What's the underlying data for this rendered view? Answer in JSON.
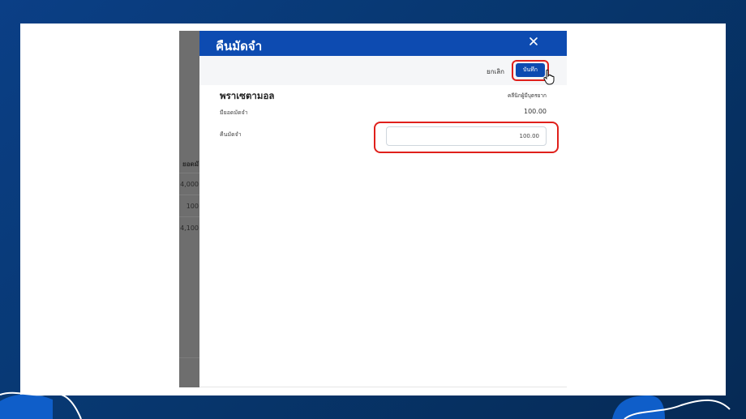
{
  "modal": {
    "title": "คืนมัดจำ",
    "toolbar": {
      "cancel_label": "ยกเลิก",
      "save_label": "บันทึก"
    },
    "customer": {
      "name": "พราเซตามอล",
      "link_label": "คลีนิกผู้มีบุตรยาก"
    },
    "deposit": {
      "label": "มียอดมัดจำ",
      "value": "100.00"
    },
    "refund": {
      "label": "คืนมัดจำ",
      "value": "100.00"
    }
  },
  "background_table": {
    "header": "ยอดมั",
    "rows": [
      "4,000",
      "100",
      "4,100"
    ]
  },
  "colors": {
    "primary": "#0d4bb1",
    "highlight": "#e0201b",
    "background": "#07376f"
  }
}
